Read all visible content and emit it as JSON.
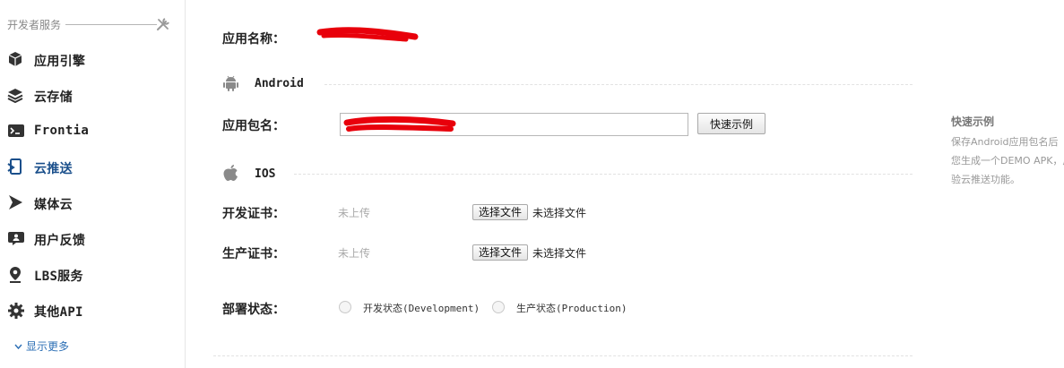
{
  "sidebar": {
    "title": "开发者服务",
    "items": [
      {
        "label": "应用引擎",
        "icon": "cube-icon"
      },
      {
        "label": "云存储",
        "icon": "layers-icon"
      },
      {
        "label": "Frontia",
        "icon": "terminal-icon"
      },
      {
        "label": "云推送",
        "icon": "mobile-push-icon",
        "active": true
      },
      {
        "label": "媒体云",
        "icon": "play-icon"
      },
      {
        "label": "用户反馈",
        "icon": "feedback-icon"
      },
      {
        "label": "LBS服务",
        "icon": "map-pin-icon"
      },
      {
        "label": "其他API",
        "icon": "gear-icon"
      }
    ],
    "more_label": "显示更多"
  },
  "form": {
    "app_name_label": "应用名称：",
    "android_title": "Android",
    "package_label": "应用包名：",
    "package_value": "",
    "demo_button": "快速示例",
    "ios_title": "IOS",
    "dev_cert_label": "开发证书：",
    "dev_cert_status": "未上传",
    "prod_cert_label": "生产证书：",
    "prod_cert_status": "未上传",
    "choose_file_button": "选择文件",
    "no_file_text": "未选择文件",
    "deploy_label": "部署状态：",
    "deploy_dev_option": "开发状态(Development)",
    "deploy_prod_option": "生产状态(Production)"
  },
  "aside": {
    "title": "快速示例",
    "lines": [
      "保存Android应用包名后",
      "您生成一个DEMO APK，用",
      "验云推送功能。"
    ]
  },
  "colors": {
    "active_nav": "#1a4f8b",
    "link": "#2c6fb5",
    "redaction": "#e8000b"
  }
}
